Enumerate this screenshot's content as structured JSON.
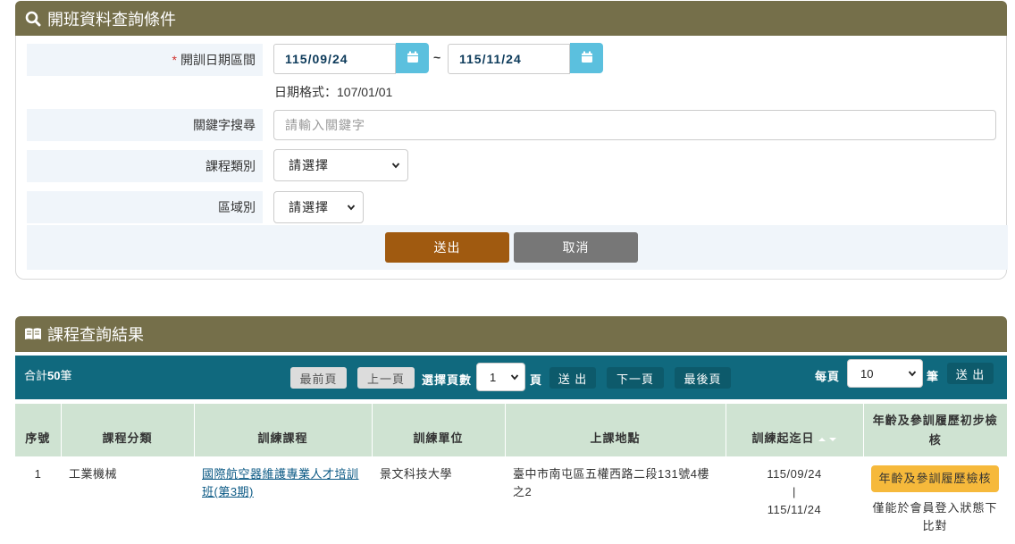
{
  "search_panel": {
    "title": "開班資料查詢條件",
    "date_range": {
      "required_mark": "*",
      "label": "開訓日期區間",
      "start": "115/09/24",
      "separator": "~",
      "end": "115/11/24",
      "hint": "日期格式：107/01/01"
    },
    "keyword": {
      "label": "關鍵字搜尋",
      "placeholder": "請輸入關鍵字"
    },
    "course_type": {
      "label": "課程類別",
      "selected": "請選擇"
    },
    "region": {
      "label": "區域別",
      "selected": "請選擇"
    },
    "submit_label": "送出",
    "cancel_label": "取消"
  },
  "results_panel": {
    "title": "課程查詢結果",
    "total_prefix": "合計",
    "total_count": "50",
    "total_suffix": "筆",
    "first_page": "最前頁",
    "prev_page": "上一頁",
    "select_page_label": "選擇頁數",
    "page_selected": "1",
    "page_suffix": "頁",
    "go_label": "送 出",
    "next_page": "下一頁",
    "last_page": "最後頁",
    "per_page_label": "每頁",
    "per_page_selected": "10",
    "per_page_suffix": "筆",
    "per_page_go": "送 出"
  },
  "table": {
    "headers": {
      "no": "序號",
      "category": "課程分類",
      "course": "訓練課程",
      "unit": "訓練單位",
      "location": "上課地點",
      "period": "訓練起迄日",
      "check": "年齡及參訓履歷初步檢核"
    },
    "rows": [
      {
        "no": "1",
        "category": "工業機械",
        "course": "國際航空器維護專業人才培訓班(第3期)",
        "unit": "景文科技大學",
        "location": "臺中市南屯區五權西路二段131號4樓之2",
        "start": "115/09/24",
        "sep": "|",
        "end": "115/11/24",
        "check_button": "年齡及參訓履歷檢核",
        "check_note": "僅能於會員登入狀態下比對"
      }
    ]
  },
  "colors": {
    "panel_header": "#756f4a",
    "toolbar": "#10697e",
    "table_header": "#cfe3d2",
    "submit": "#a05a10",
    "cancel": "#777777",
    "calendar": "#5bc0de",
    "check_button": "#f6b93b"
  },
  "icons": {
    "search_header": "magnifier-icon",
    "results_header": "open-book-icon",
    "calendar": "calendar-icon",
    "sort": "sort-arrows-icon"
  }
}
